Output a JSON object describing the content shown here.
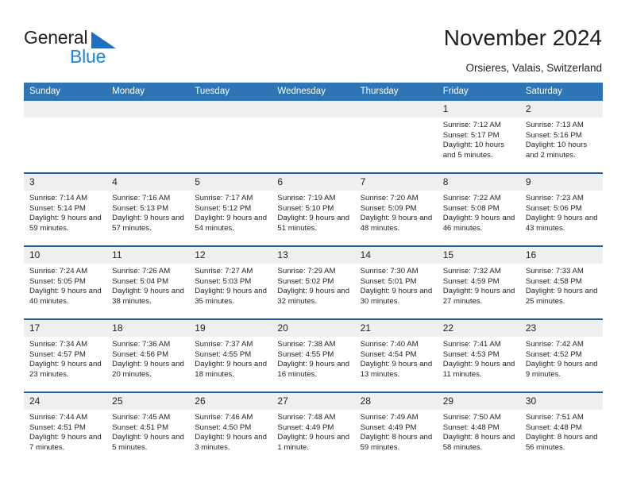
{
  "brand": {
    "name_dark": "General",
    "name_blue": "Blue",
    "logo_icon": "blue-triangle-logo",
    "accent_color": "#1f83d1",
    "triangle_color": "#1f6fc0"
  },
  "header": {
    "title": "November 2024",
    "location": "Orsieres, Valais, Switzerland"
  },
  "calendar": {
    "header_bg": "#2e75b6",
    "header_text_color": "#ffffff",
    "date_band_bg": "#efefef",
    "row_divider_color": "#1f5fa0",
    "weekdays": [
      "Sunday",
      "Monday",
      "Tuesday",
      "Wednesday",
      "Thursday",
      "Friday",
      "Saturday"
    ],
    "weeks": [
      [
        {
          "day": "",
          "empty": true
        },
        {
          "day": "",
          "empty": true
        },
        {
          "day": "",
          "empty": true
        },
        {
          "day": "",
          "empty": true
        },
        {
          "day": "",
          "empty": true
        },
        {
          "day": "1",
          "sunrise": "Sunrise: 7:12 AM",
          "sunset": "Sunset: 5:17 PM",
          "daylight": "Daylight: 10 hours and 5 minutes."
        },
        {
          "day": "2",
          "sunrise": "Sunrise: 7:13 AM",
          "sunset": "Sunset: 5:16 PM",
          "daylight": "Daylight: 10 hours and 2 minutes."
        }
      ],
      [
        {
          "day": "3",
          "sunrise": "Sunrise: 7:14 AM",
          "sunset": "Sunset: 5:14 PM",
          "daylight": "Daylight: 9 hours and 59 minutes."
        },
        {
          "day": "4",
          "sunrise": "Sunrise: 7:16 AM",
          "sunset": "Sunset: 5:13 PM",
          "daylight": "Daylight: 9 hours and 57 minutes."
        },
        {
          "day": "5",
          "sunrise": "Sunrise: 7:17 AM",
          "sunset": "Sunset: 5:12 PM",
          "daylight": "Daylight: 9 hours and 54 minutes."
        },
        {
          "day": "6",
          "sunrise": "Sunrise: 7:19 AM",
          "sunset": "Sunset: 5:10 PM",
          "daylight": "Daylight: 9 hours and 51 minutes."
        },
        {
          "day": "7",
          "sunrise": "Sunrise: 7:20 AM",
          "sunset": "Sunset: 5:09 PM",
          "daylight": "Daylight: 9 hours and 48 minutes."
        },
        {
          "day": "8",
          "sunrise": "Sunrise: 7:22 AM",
          "sunset": "Sunset: 5:08 PM",
          "daylight": "Daylight: 9 hours and 46 minutes."
        },
        {
          "day": "9",
          "sunrise": "Sunrise: 7:23 AM",
          "sunset": "Sunset: 5:06 PM",
          "daylight": "Daylight: 9 hours and 43 minutes."
        }
      ],
      [
        {
          "day": "10",
          "sunrise": "Sunrise: 7:24 AM",
          "sunset": "Sunset: 5:05 PM",
          "daylight": "Daylight: 9 hours and 40 minutes."
        },
        {
          "day": "11",
          "sunrise": "Sunrise: 7:26 AM",
          "sunset": "Sunset: 5:04 PM",
          "daylight": "Daylight: 9 hours and 38 minutes."
        },
        {
          "day": "12",
          "sunrise": "Sunrise: 7:27 AM",
          "sunset": "Sunset: 5:03 PM",
          "daylight": "Daylight: 9 hours and 35 minutes."
        },
        {
          "day": "13",
          "sunrise": "Sunrise: 7:29 AM",
          "sunset": "Sunset: 5:02 PM",
          "daylight": "Daylight: 9 hours and 32 minutes."
        },
        {
          "day": "14",
          "sunrise": "Sunrise: 7:30 AM",
          "sunset": "Sunset: 5:01 PM",
          "daylight": "Daylight: 9 hours and 30 minutes."
        },
        {
          "day": "15",
          "sunrise": "Sunrise: 7:32 AM",
          "sunset": "Sunset: 4:59 PM",
          "daylight": "Daylight: 9 hours and 27 minutes."
        },
        {
          "day": "16",
          "sunrise": "Sunrise: 7:33 AM",
          "sunset": "Sunset: 4:58 PM",
          "daylight": "Daylight: 9 hours and 25 minutes."
        }
      ],
      [
        {
          "day": "17",
          "sunrise": "Sunrise: 7:34 AM",
          "sunset": "Sunset: 4:57 PM",
          "daylight": "Daylight: 9 hours and 23 minutes."
        },
        {
          "day": "18",
          "sunrise": "Sunrise: 7:36 AM",
          "sunset": "Sunset: 4:56 PM",
          "daylight": "Daylight: 9 hours and 20 minutes."
        },
        {
          "day": "19",
          "sunrise": "Sunrise: 7:37 AM",
          "sunset": "Sunset: 4:55 PM",
          "daylight": "Daylight: 9 hours and 18 minutes."
        },
        {
          "day": "20",
          "sunrise": "Sunrise: 7:38 AM",
          "sunset": "Sunset: 4:55 PM",
          "daylight": "Daylight: 9 hours and 16 minutes."
        },
        {
          "day": "21",
          "sunrise": "Sunrise: 7:40 AM",
          "sunset": "Sunset: 4:54 PM",
          "daylight": "Daylight: 9 hours and 13 minutes."
        },
        {
          "day": "22",
          "sunrise": "Sunrise: 7:41 AM",
          "sunset": "Sunset: 4:53 PM",
          "daylight": "Daylight: 9 hours and 11 minutes."
        },
        {
          "day": "23",
          "sunrise": "Sunrise: 7:42 AM",
          "sunset": "Sunset: 4:52 PM",
          "daylight": "Daylight: 9 hours and 9 minutes."
        }
      ],
      [
        {
          "day": "24",
          "sunrise": "Sunrise: 7:44 AM",
          "sunset": "Sunset: 4:51 PM",
          "daylight": "Daylight: 9 hours and 7 minutes."
        },
        {
          "day": "25",
          "sunrise": "Sunrise: 7:45 AM",
          "sunset": "Sunset: 4:51 PM",
          "daylight": "Daylight: 9 hours and 5 minutes."
        },
        {
          "day": "26",
          "sunrise": "Sunrise: 7:46 AM",
          "sunset": "Sunset: 4:50 PM",
          "daylight": "Daylight: 9 hours and 3 minutes."
        },
        {
          "day": "27",
          "sunrise": "Sunrise: 7:48 AM",
          "sunset": "Sunset: 4:49 PM",
          "daylight": "Daylight: 9 hours and 1 minute."
        },
        {
          "day": "28",
          "sunrise": "Sunrise: 7:49 AM",
          "sunset": "Sunset: 4:49 PM",
          "daylight": "Daylight: 8 hours and 59 minutes."
        },
        {
          "day": "29",
          "sunrise": "Sunrise: 7:50 AM",
          "sunset": "Sunset: 4:48 PM",
          "daylight": "Daylight: 8 hours and 58 minutes."
        },
        {
          "day": "30",
          "sunrise": "Sunrise: 7:51 AM",
          "sunset": "Sunset: 4:48 PM",
          "daylight": "Daylight: 8 hours and 56 minutes."
        }
      ]
    ]
  }
}
